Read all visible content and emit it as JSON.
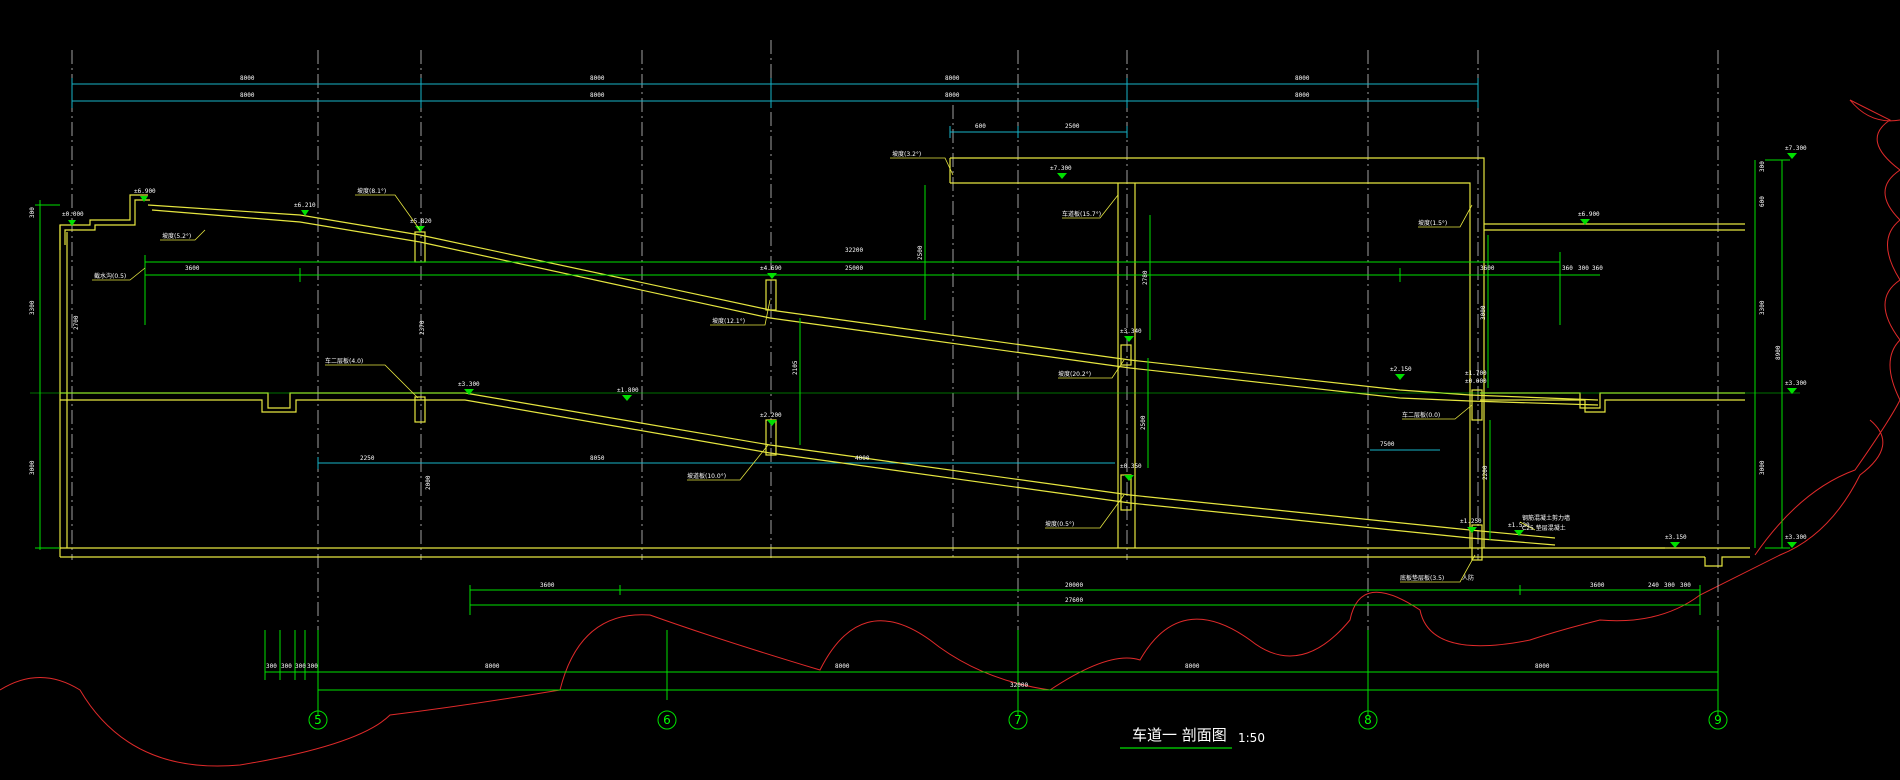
{
  "drawing": {
    "title": "车道一 剖面图",
    "scale": "1:50",
    "axes": [
      "5",
      "6",
      "7",
      "8",
      "9"
    ],
    "top_dims_row1": [
      "8000",
      "8000",
      "8000",
      "8000"
    ],
    "top_dims_row2": [
      "8000",
      "8000",
      "8000",
      "8000"
    ],
    "upper_dims": [
      "600",
      "2500"
    ],
    "mid_dims": [
      "3600",
      "3600",
      "25000",
      "32200",
      "360",
      "300",
      "360"
    ],
    "lower_dims": [
      "2250",
      "8050",
      "4000",
      "7500"
    ],
    "bottom_dims_row1": [
      "3600",
      "20000",
      "3600",
      "240",
      "300",
      "300"
    ],
    "bottom_dims_row2": [
      "27600"
    ],
    "axis_dims_small": [
      "300",
      "300",
      "300",
      "300"
    ],
    "axis_dims": [
      "8000",
      "8000",
      "8000",
      "8000"
    ],
    "axis_total": "32000",
    "left_vert_dims": [
      "300",
      "3300",
      "3000"
    ],
    "right_vert_dims": [
      "300",
      "600",
      "3300",
      "8900",
      "3000"
    ],
    "inner_vert_dims": [
      "2700",
      "2370",
      "2500",
      "2105",
      "2780",
      "2500",
      "2000",
      "3000",
      "2200"
    ],
    "levels": [
      "±0.000",
      "±6.900",
      "±6.210",
      "±5.820",
      "±4.690",
      "±3.340",
      "±2.150",
      "±1.700",
      "±7.300",
      "±6.900",
      "±3.300",
      "±1.800",
      "±2.200",
      "±0.000",
      "±0.350",
      "±1.250",
      "±1.530",
      "±3.150",
      "±3.300",
      "±0.000",
      "±7.300",
      "±3.300",
      "±0.000"
    ],
    "annotations": [
      "坡度(5.2°)",
      "坡度(8.1°)",
      "截水沟(0.5)",
      "坡度(3.2°)",
      "车二层板(4.0)",
      "车道板(15.7°)",
      "坡度(1.5°)",
      "坡度(20.2°)",
      "坡度(12.1°)",
      "坡度(0.5°)",
      "车二层板(0.0)",
      "坡道板(10.0°)",
      "底板垫层板(3.5)",
      "人防",
      "钢筋混凝土剪力墙",
      "C25 垫层混凝土"
    ]
  }
}
